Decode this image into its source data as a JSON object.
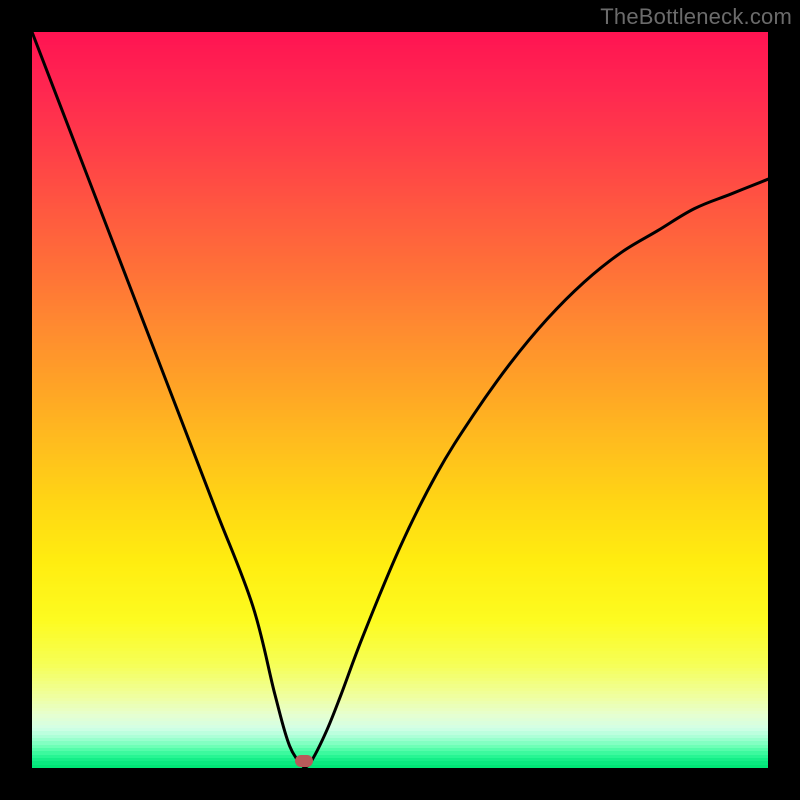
{
  "watermark": {
    "text": "TheBottleneck.com"
  },
  "chart_data": {
    "type": "line",
    "title": "",
    "xlabel": "",
    "ylabel": "",
    "xlim": [
      0,
      100
    ],
    "ylim": [
      0,
      100
    ],
    "grid": false,
    "legend": false,
    "series": [
      {
        "name": "bottleneck-curve",
        "x": [
          0,
          5,
          10,
          15,
          20,
          25,
          30,
          33,
          35,
          37,
          38,
          40,
          42,
          45,
          50,
          55,
          60,
          65,
          70,
          75,
          80,
          85,
          90,
          95,
          100
        ],
        "y": [
          100,
          87,
          74,
          61,
          48,
          35,
          22,
          10,
          3,
          0,
          1,
          5,
          10,
          18,
          30,
          40,
          48,
          55,
          61,
          66,
          70,
          73,
          76,
          78,
          80
        ]
      }
    ],
    "cusp": {
      "x": 37,
      "y": 0
    },
    "marker": {
      "x": 37,
      "y": 1,
      "color": "#b85a5a"
    },
    "gradient_stops": [
      {
        "pos": 0.0,
        "color": "#ff1452"
      },
      {
        "pos": 0.08,
        "color": "#ff2850"
      },
      {
        "pos": 0.16,
        "color": "#ff3f48"
      },
      {
        "pos": 0.24,
        "color": "#ff5840"
      },
      {
        "pos": 0.32,
        "color": "#ff7038"
      },
      {
        "pos": 0.4,
        "color": "#ff8a30"
      },
      {
        "pos": 0.48,
        "color": "#ffa326"
      },
      {
        "pos": 0.56,
        "color": "#ffbd1e"
      },
      {
        "pos": 0.64,
        "color": "#ffd614"
      },
      {
        "pos": 0.72,
        "color": "#ffed10"
      },
      {
        "pos": 0.8,
        "color": "#fdfb20"
      },
      {
        "pos": 0.86,
        "color": "#f6ff55"
      },
      {
        "pos": 0.905,
        "color": "#efffa0"
      },
      {
        "pos": 0.93,
        "color": "#e6ffd0"
      },
      {
        "pos": 0.948,
        "color": "#d2ffe6"
      },
      {
        "pos": 0.96,
        "color": "#a8ffd6"
      },
      {
        "pos": 0.972,
        "color": "#70ffb8"
      },
      {
        "pos": 0.984,
        "color": "#30f898"
      },
      {
        "pos": 0.992,
        "color": "#10ec85"
      },
      {
        "pos": 1.0,
        "color": "#00e676"
      }
    ]
  }
}
